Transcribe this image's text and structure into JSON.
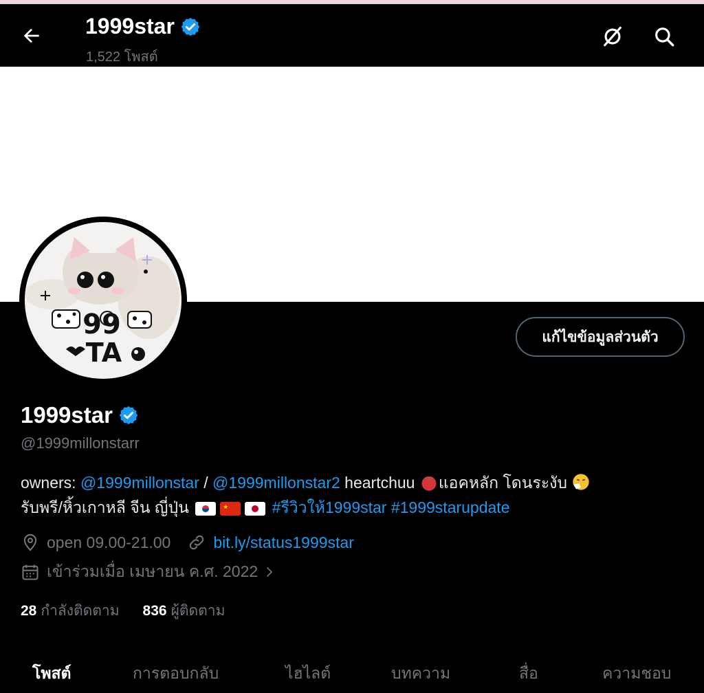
{
  "header": {
    "title": "1999star",
    "post_count": "1,522 โพสต์"
  },
  "profile": {
    "edit_label": "แก้ไขข้อมูลส่วนตัว",
    "name": "1999star",
    "handle": "@1999millonstarr",
    "bio": {
      "prefix": "owners: ",
      "mention1": "@1999millonstar",
      "sep": " / ",
      "mention2": "@1999millonstar2",
      "text1": " heartchuu ",
      "text2": "แอคหลัก โดนระงับ ",
      "line2": "รับพรี/หิ้วเกาหลี จีน ญี่ปุ่น ",
      "hashtag1": "#รีวิวให้1999star",
      "hashtag2": " #1999starupdate"
    },
    "location": "open 09.00-21.00",
    "website": "bit.ly/status1999star",
    "joined": "เข้าร่วมเมื่อ เมษายน ค.ศ. 2022"
  },
  "stats": {
    "following_count": "28",
    "following_label": "กำลังติดตาม",
    "followers_count": "836",
    "followers_label": "ผู้ติดตาม"
  },
  "tabs": [
    {
      "label": "โพสต์"
    },
    {
      "label": "การตอบกลับ"
    },
    {
      "label": "ไฮไลต์"
    },
    {
      "label": "บทความ"
    },
    {
      "label": "สื่อ"
    },
    {
      "label": "ความชอบ"
    }
  ],
  "avatar_text": "1999 STAR",
  "colors": {
    "background": "#000000",
    "accent": "#1d9bf0",
    "verified": "#1d9bf0",
    "secondary_text": "#71767b"
  }
}
